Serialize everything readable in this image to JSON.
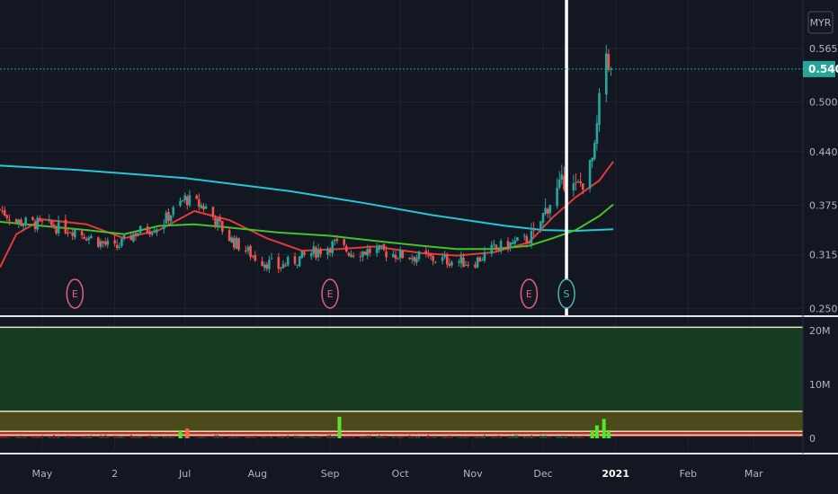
{
  "currency": "MYR",
  "chart_data": {
    "type": "candlestick",
    "x_range": [
      "2020-04-13",
      "2021-03-22"
    ],
    "x_ticks": [
      {
        "date": "2020-05-01",
        "label": "May",
        "bold": false
      },
      {
        "date": "2020-06-01",
        "label": "2",
        "bold": false
      },
      {
        "date": "2020-07-01",
        "label": "Jul",
        "bold": false
      },
      {
        "date": "2020-08-01",
        "label": "Aug",
        "bold": false
      },
      {
        "date": "2020-09-01",
        "label": "Sep",
        "bold": false
      },
      {
        "date": "2020-10-01",
        "label": "Oct",
        "bold": false
      },
      {
        "date": "2020-11-01",
        "label": "Nov",
        "bold": false
      },
      {
        "date": "2020-12-01",
        "label": "Dec",
        "bold": false
      },
      {
        "date": "2021-01-01",
        "label": "2021",
        "bold": true
      },
      {
        "date": "2021-02-01",
        "label": "Feb",
        "bold": false
      },
      {
        "date": "2021-03-01",
        "label": "Mar",
        "bold": false
      }
    ],
    "price_axis": {
      "ticks": [
        "0.250",
        "0.315",
        "0.375",
        "0.440",
        "0.500",
        "0.565"
      ],
      "current_price": "0.540",
      "ylim": [
        0.245,
        0.615
      ]
    },
    "volume_axis": {
      "ticks": [
        "0",
        "10M",
        "20M"
      ],
      "ylim": [
        -2,
        22
      ]
    },
    "candles_anchor": {
      "dates": [
        "2020-04-13",
        "2020-04-20",
        "2020-05-01",
        "2020-05-15",
        "2020-06-01",
        "2020-06-10",
        "2020-06-20",
        "2020-07-01",
        "2020-07-10",
        "2020-07-20",
        "2020-08-01",
        "2020-08-10",
        "2020-08-25",
        "2020-09-03",
        "2020-09-10",
        "2020-09-20",
        "2020-10-01",
        "2020-10-15",
        "2020-11-01",
        "2020-11-10",
        "2020-11-20",
        "2020-11-27",
        "2020-12-03",
        "2020-12-10",
        "2020-12-15",
        "2020-12-20",
        "2020-12-23",
        "2020-12-25",
        "2020-12-28",
        "2020-12-30"
      ],
      "closes": [
        0.37,
        0.355,
        0.352,
        0.345,
        0.322,
        0.342,
        0.35,
        0.383,
        0.372,
        0.335,
        0.31,
        0.3,
        0.318,
        0.328,
        0.318,
        0.32,
        0.315,
        0.31,
        0.305,
        0.322,
        0.33,
        0.336,
        0.375,
        0.405,
        0.395,
        0.41,
        0.44,
        0.5,
        0.56,
        0.535
      ]
    },
    "volume_highlights": [
      {
        "date": "2020-06-29",
        "value": 1.5,
        "up": true
      },
      {
        "date": "2020-07-02",
        "value": 1.8,
        "up": false
      },
      {
        "date": "2020-09-05",
        "value": 4.0,
        "up": true
      },
      {
        "date": "2020-12-22",
        "value": 1.5,
        "up": true
      },
      {
        "date": "2020-12-24",
        "value": 2.4,
        "up": true
      },
      {
        "date": "2020-12-27",
        "value": 3.6,
        "up": true
      },
      {
        "date": "2020-12-29",
        "value": 1.5,
        "up": true
      }
    ],
    "series": [
      {
        "name": "",
        "color": "#26c6da",
        "points": [
          [
            "2020-04-13",
            0.423
          ],
          [
            "2020-05-15",
            0.418
          ],
          [
            "2020-07-01",
            0.408
          ],
          [
            "2020-08-15",
            0.392
          ],
          [
            "2020-09-15",
            0.378
          ],
          [
            "2020-10-15",
            0.363
          ],
          [
            "2020-11-15",
            0.35
          ],
          [
            "2020-12-01",
            0.345
          ],
          [
            "2020-12-15",
            0.344
          ],
          [
            "2020-12-31",
            0.346
          ]
        ]
      },
      {
        "name": "",
        "color": "#e53935",
        "points": [
          [
            "2020-04-13",
            0.3
          ],
          [
            "2020-04-20",
            0.34
          ],
          [
            "2020-05-01",
            0.358
          ],
          [
            "2020-05-20",
            0.352
          ],
          [
            "2020-06-05",
            0.335
          ],
          [
            "2020-06-20",
            0.345
          ],
          [
            "2020-07-05",
            0.368
          ],
          [
            "2020-07-20",
            0.357
          ],
          [
            "2020-08-05",
            0.335
          ],
          [
            "2020-08-20",
            0.32
          ],
          [
            "2020-09-05",
            0.322
          ],
          [
            "2020-09-20",
            0.325
          ],
          [
            "2020-10-10",
            0.317
          ],
          [
            "2020-10-25",
            0.314
          ],
          [
            "2020-11-10",
            0.318
          ],
          [
            "2020-11-25",
            0.33
          ],
          [
            "2020-12-05",
            0.36
          ],
          [
            "2020-12-15",
            0.385
          ],
          [
            "2020-12-25",
            0.405
          ],
          [
            "2020-12-31",
            0.428
          ]
        ]
      },
      {
        "name": "",
        "color": "#43c22b",
        "points": [
          [
            "2020-04-13",
            0.355
          ],
          [
            "2020-05-01",
            0.35
          ],
          [
            "2020-05-20",
            0.345
          ],
          [
            "2020-06-05",
            0.34
          ],
          [
            "2020-06-20",
            0.35
          ],
          [
            "2020-07-05",
            0.352
          ],
          [
            "2020-07-20",
            0.348
          ],
          [
            "2020-08-10",
            0.342
          ],
          [
            "2020-09-01",
            0.338
          ],
          [
            "2020-09-20",
            0.332
          ],
          [
            "2020-10-10",
            0.326
          ],
          [
            "2020-10-25",
            0.322
          ],
          [
            "2020-11-10",
            0.322
          ],
          [
            "2020-11-25",
            0.326
          ],
          [
            "2020-12-05",
            0.335
          ],
          [
            "2020-12-15",
            0.345
          ],
          [
            "2020-12-25",
            0.362
          ],
          [
            "2020-12-31",
            0.376
          ]
        ]
      }
    ],
    "events": [
      {
        "date": "2020-05-15",
        "label": "E",
        "kind": "earnings"
      },
      {
        "date": "2020-09-01",
        "label": "E",
        "kind": "earnings"
      },
      {
        "date": "2020-11-25",
        "label": "E",
        "kind": "earnings"
      },
      {
        "date": "2020-12-11",
        "label": "S",
        "kind": "split"
      }
    ],
    "marker_line": {
      "date": "2020-12-11"
    },
    "volume_bands": [
      {
        "from": 0.3,
        "to": 1.4,
        "color": "#c62828"
      },
      {
        "from": 1.4,
        "to": 5.0,
        "color": "#4a4a1a"
      },
      {
        "from": 5.0,
        "to": 20.6,
        "color": "#163a22"
      }
    ],
    "volume_band_lines": [
      0.6,
      1.3,
      5.0,
      20.6
    ]
  }
}
